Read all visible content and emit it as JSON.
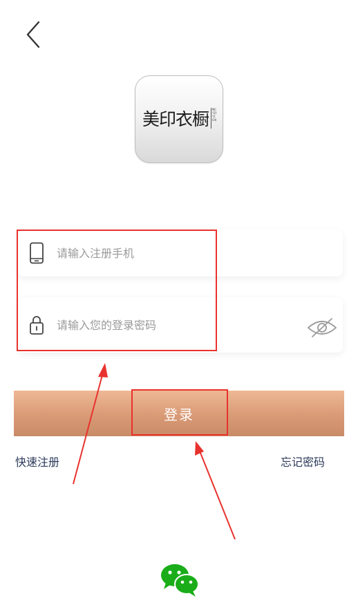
{
  "header": {
    "back_icon": "chevron-left-icon"
  },
  "logo": {
    "text": "美印衣橱",
    "side_text": "MEI YIN YI CHU"
  },
  "form": {
    "phone": {
      "icon": "phone-icon",
      "placeholder": "请输入注册手机",
      "value": ""
    },
    "password": {
      "icon": "lock-icon",
      "placeholder": "请输入您的登录密码",
      "value": "",
      "toggle_icon": "eye-off-icon"
    },
    "login_label": "登录",
    "register_label": "快速注册",
    "forgot_label": "忘记密码"
  },
  "social": {
    "wechat_icon": "wechat-icon"
  },
  "annotations": {
    "color": "#e8322d",
    "boxes": [
      "input-fields",
      "login-button"
    ],
    "arrows": 2
  },
  "colors": {
    "button_gradient_top": "#efb895",
    "button_gradient_bottom": "#c98b67",
    "link_text": "#2b3a5a",
    "wechat_green": "#1aad19",
    "placeholder": "#9a9a9a"
  }
}
